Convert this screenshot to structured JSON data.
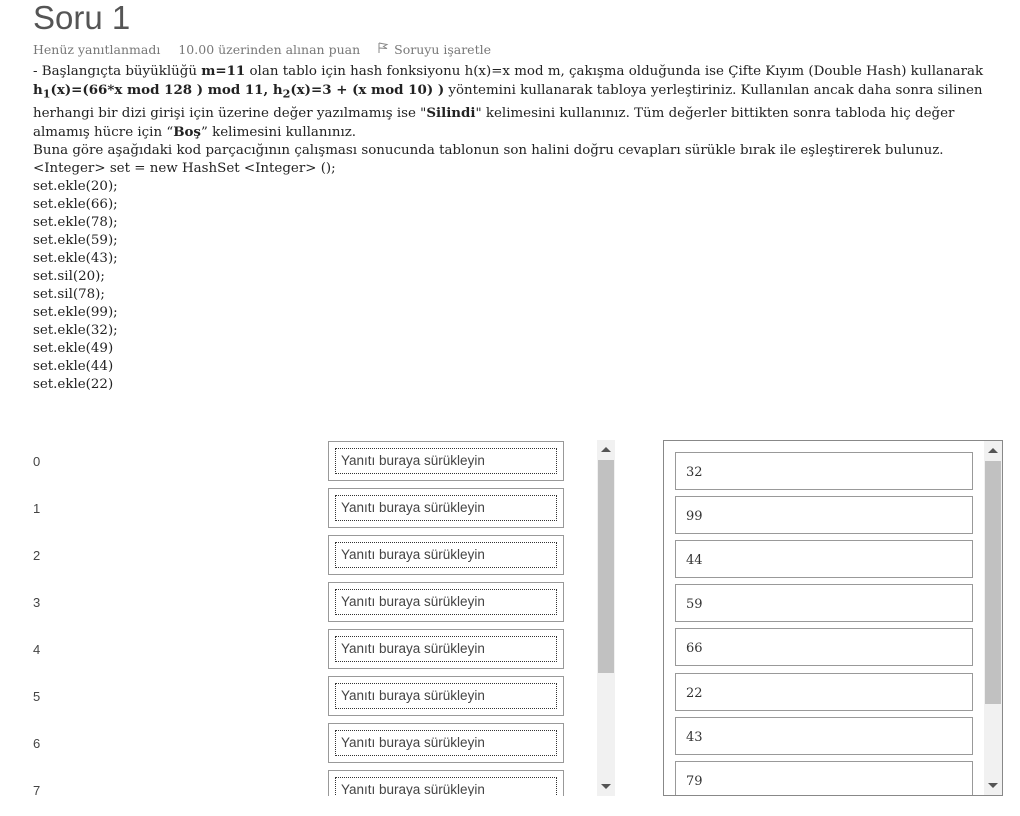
{
  "title": "Soru 1",
  "meta": {
    "status": "Henüz yanıtlanmadı",
    "points": "10.00 üzerinden alınan puan",
    "flag_label": "Soruyu işaretle"
  },
  "question": {
    "p1_a": "- Başlangıçta büyüklüğü ",
    "p1_m": "m=11",
    "p1_b": " olan tablo için hash fonksiyonu h(x)=x mod m, çakışma olduğunda ise Çifte Kıyım (Double Hash) kullanarak ",
    "h1": "h",
    "h1_sub": "1",
    "h1_rest": "(x)=(66*x mod 128 ) mod 11, h",
    "h2_sub": "2",
    "h2_rest": "(x)=3 + (x mod 10) )",
    "p1_c": " yöntemini kullanarak tabloya yerleştiriniz. Kullanılan ancak daha sonra silinen herhangi bir dizi girişi için üzerine değer yazılmamış ise \"",
    "silindi": "Silindi",
    "p1_d": "\" kelimesini kullanınız. Tüm değerler bittikten sonra tabloda hiç değer almamış hücre için “",
    "bos": "Boş",
    "p1_e": "” kelimesini kullanınız.",
    "p2": "Buna göre aşağıdaki kod parçacığının çalışması sonucunda tablonun son halini doğru cevapları sürükle bırak ile eşleştirerek bulunuz.",
    "code": [
      "<Integer> set = new HashSet <Integer> ();",
      "set.ekle(20);",
      "set.ekle(66);",
      "set.ekle(78);",
      "set.ekle(59);",
      "set.ekle(43);",
      "set.sil(20);",
      "set.sil(78);",
      "set.ekle(99);",
      "set.ekle(32);",
      "set.ekle(49)",
      "set.ekle(44)",
      "set.ekle(22)"
    ]
  },
  "table": {
    "placeholder": "Yanıtı buraya sürükleyin",
    "indices": [
      "0",
      "1",
      "2",
      "3",
      "4",
      "5",
      "6",
      "7"
    ]
  },
  "options": [
    "32",
    "99",
    "44",
    "59",
    "66",
    "22",
    "43",
    "79"
  ]
}
